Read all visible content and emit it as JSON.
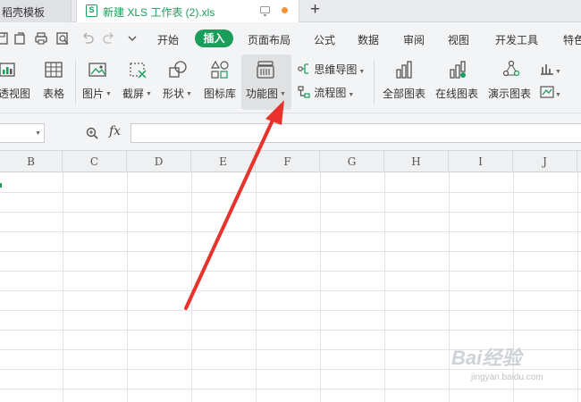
{
  "tabs": {
    "template_tab": "稻壳模板",
    "file_tab": "新建 XLS 工作表 (2).xls",
    "new_tab": "+"
  },
  "menu": {
    "items": [
      "开始",
      "插入",
      "页面布局",
      "公式",
      "数据",
      "审阅",
      "视图",
      "开发工具",
      "特色"
    ],
    "active": "插入"
  },
  "ribbon": {
    "pivot_view": "透视图",
    "table": "表格",
    "picture": "图片",
    "screenshot": "截屏",
    "shapes": "形状",
    "icon_library": "图标库",
    "function_chart": "功能图",
    "mind_map": "思维导图",
    "flowchart": "流程图",
    "all_charts": "全部图表",
    "online_charts": "在线图表",
    "demo_charts": "演示图表"
  },
  "formula_bar": {
    "fx_label": "fx",
    "name_box_value": "",
    "formula_value": ""
  },
  "grid": {
    "columns": [
      "B",
      "C",
      "D",
      "E",
      "F",
      "G",
      "H",
      "I",
      "J"
    ]
  },
  "watermark": {
    "brand": "Bai经验",
    "url": "jingyan.baidu.com"
  },
  "colors": {
    "accent": "#1b9e5a",
    "arrow": "#e8332c"
  }
}
